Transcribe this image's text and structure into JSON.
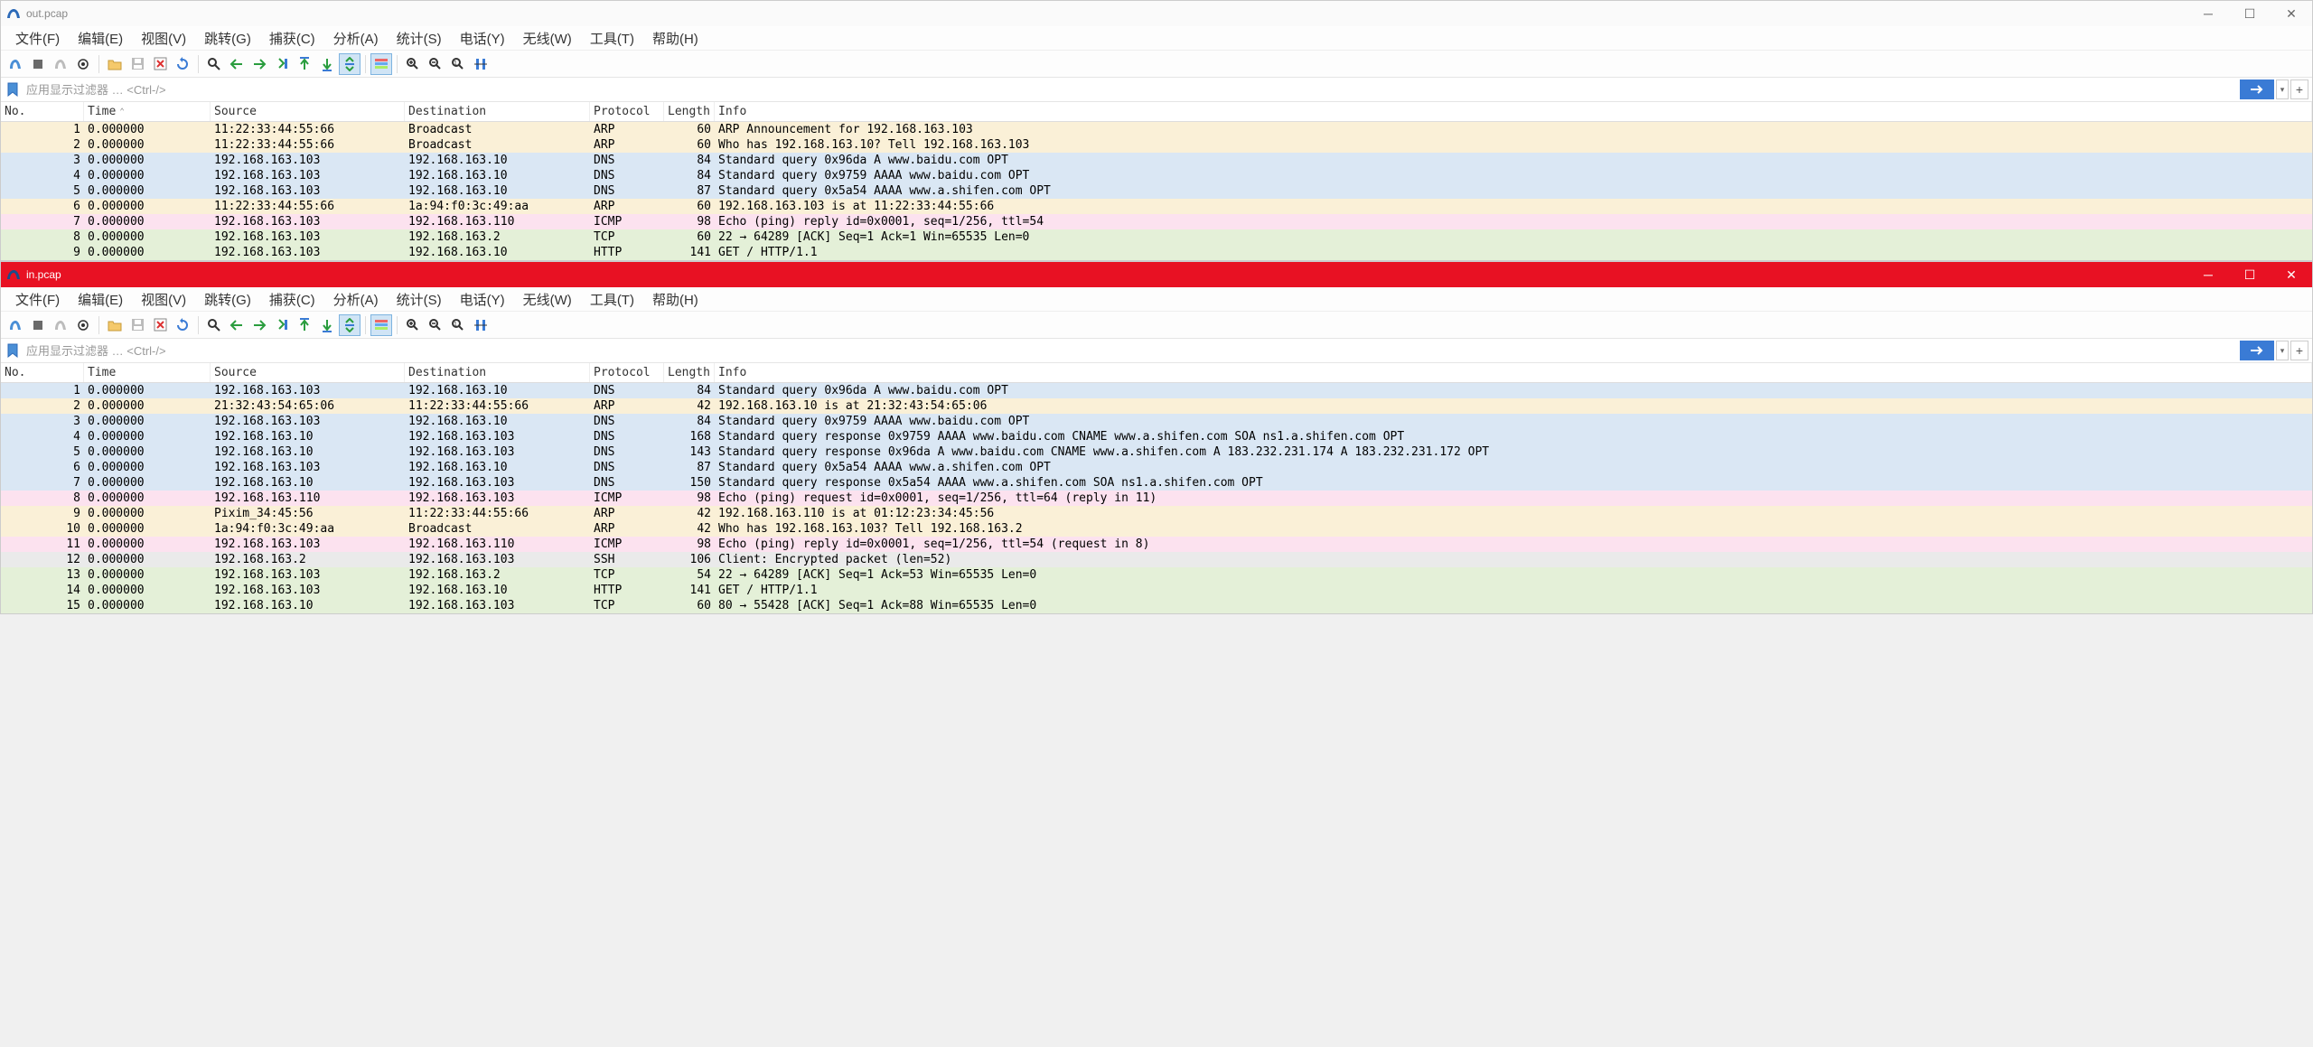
{
  "windows": {
    "out": {
      "title": "out.pcap"
    },
    "in": {
      "title": "in.pcap"
    }
  },
  "menu": {
    "file": "文件(F)",
    "edit": "编辑(E)",
    "view": "视图(V)",
    "goto": "跳转(G)",
    "capture": "捕获(C)",
    "analyze": "分析(A)",
    "stats": "统计(S)",
    "tele": "电话(Y)",
    "wireless": "无线(W)",
    "tools": "工具(T)",
    "help": "帮助(H)"
  },
  "filter": {
    "placeholder": "应用显示过滤器 … <Ctrl-/>"
  },
  "cols": {
    "no": "No.",
    "time": "Time",
    "src": "Source",
    "dst": "Destination",
    "proto": "Protocol",
    "len": "Length",
    "info": "Info"
  },
  "out_rows": [
    {
      "no": "1",
      "time": "0.000000",
      "src": "11:22:33:44:55:66",
      "dst": "Broadcast",
      "proto": "ARP",
      "len": "60",
      "info": "ARP Announcement for 192.168.163.103",
      "cls": "c-arp-cream"
    },
    {
      "no": "2",
      "time": "0.000000",
      "src": "11:22:33:44:55:66",
      "dst": "Broadcast",
      "proto": "ARP",
      "len": "60",
      "info": "Who has 192.168.163.10? Tell 192.168.163.103",
      "cls": "c-arp-cream"
    },
    {
      "no": "3",
      "time": "0.000000",
      "src": "192.168.163.103",
      "dst": "192.168.163.10",
      "proto": "DNS",
      "len": "84",
      "info": "Standard query 0x96da A www.baidu.com OPT",
      "cls": "c-dns-blue"
    },
    {
      "no": "4",
      "time": "0.000000",
      "src": "192.168.163.103",
      "dst": "192.168.163.10",
      "proto": "DNS",
      "len": "84",
      "info": "Standard query 0x9759 AAAA www.baidu.com OPT",
      "cls": "c-dns-blue"
    },
    {
      "no": "5",
      "time": "0.000000",
      "src": "192.168.163.103",
      "dst": "192.168.163.10",
      "proto": "DNS",
      "len": "87",
      "info": "Standard query 0x5a54 AAAA www.a.shifen.com OPT",
      "cls": "c-dns-blue"
    },
    {
      "no": "6",
      "time": "0.000000",
      "src": "11:22:33:44:55:66",
      "dst": "1a:94:f0:3c:49:aa",
      "proto": "ARP",
      "len": "60",
      "info": "192.168.163.103 is at 11:22:33:44:55:66",
      "cls": "c-arp-cream"
    },
    {
      "no": "7",
      "time": "0.000000",
      "src": "192.168.163.103",
      "dst": "192.168.163.110",
      "proto": "ICMP",
      "len": "98",
      "info": "Echo (ping) reply    id=0x0001, seq=1/256, ttl=54",
      "cls": "c-icmp-pink"
    },
    {
      "no": "8",
      "time": "0.000000",
      "src": "192.168.163.103",
      "dst": "192.168.163.2",
      "proto": "TCP",
      "len": "60",
      "info": "22 → 64289 [ACK] Seq=1 Ack=1 Win=65535 Len=0",
      "cls": "c-tcp-green"
    },
    {
      "no": "9",
      "time": "0.000000",
      "src": "192.168.163.103",
      "dst": "192.168.163.10",
      "proto": "HTTP",
      "len": "141",
      "info": "GET / HTTP/1.1",
      "cls": "c-http-green"
    }
  ],
  "in_rows": [
    {
      "no": "1",
      "time": "0.000000",
      "src": "192.168.163.103",
      "dst": "192.168.163.10",
      "proto": "DNS",
      "len": "84",
      "info": "Standard query 0x96da A www.baidu.com OPT",
      "cls": "c-dns-blue"
    },
    {
      "no": "2",
      "time": "0.000000",
      "src": "21:32:43:54:65:06",
      "dst": "11:22:33:44:55:66",
      "proto": "ARP",
      "len": "42",
      "info": "192.168.163.10 is at 21:32:43:54:65:06",
      "cls": "c-arp-cream"
    },
    {
      "no": "3",
      "time": "0.000000",
      "src": "192.168.163.103",
      "dst": "192.168.163.10",
      "proto": "DNS",
      "len": "84",
      "info": "Standard query 0x9759 AAAA www.baidu.com OPT",
      "cls": "c-dns-blue"
    },
    {
      "no": "4",
      "time": "0.000000",
      "src": "192.168.163.10",
      "dst": "192.168.163.103",
      "proto": "DNS",
      "len": "168",
      "info": "Standard query response 0x9759 AAAA www.baidu.com CNAME www.a.shifen.com SOA ns1.a.shifen.com OPT",
      "cls": "c-dns-blue"
    },
    {
      "no": "5",
      "time": "0.000000",
      "src": "192.168.163.10",
      "dst": "192.168.163.103",
      "proto": "DNS",
      "len": "143",
      "info": "Standard query response 0x96da A www.baidu.com CNAME www.a.shifen.com A 183.232.231.174 A 183.232.231.172 OPT",
      "cls": "c-dns-blue"
    },
    {
      "no": "6",
      "time": "0.000000",
      "src": "192.168.163.103",
      "dst": "192.168.163.10",
      "proto": "DNS",
      "len": "87",
      "info": "Standard query 0x5a54 AAAA www.a.shifen.com OPT",
      "cls": "c-dns-blue"
    },
    {
      "no": "7",
      "time": "0.000000",
      "src": "192.168.163.10",
      "dst": "192.168.163.103",
      "proto": "DNS",
      "len": "150",
      "info": "Standard query response 0x5a54 AAAA www.a.shifen.com SOA ns1.a.shifen.com OPT",
      "cls": "c-dns-blue"
    },
    {
      "no": "8",
      "time": "0.000000",
      "src": "192.168.163.110",
      "dst": "192.168.163.103",
      "proto": "ICMP",
      "len": "98",
      "info": "Echo (ping) request  id=0x0001, seq=1/256, ttl=64 (reply in 11)",
      "cls": "c-icmp-pink"
    },
    {
      "no": "9",
      "time": "0.000000",
      "src": "Pixim_34:45:56",
      "dst": "11:22:33:44:55:66",
      "proto": "ARP",
      "len": "42",
      "info": "192.168.163.110 is at 01:12:23:34:45:56",
      "cls": "c-arp-cream"
    },
    {
      "no": "10",
      "time": "0.000000",
      "src": "1a:94:f0:3c:49:aa",
      "dst": "Broadcast",
      "proto": "ARP",
      "len": "42",
      "info": "Who has 192.168.163.103? Tell 192.168.163.2",
      "cls": "c-arp-cream"
    },
    {
      "no": "11",
      "time": "0.000000",
      "src": "192.168.163.103",
      "dst": "192.168.163.110",
      "proto": "ICMP",
      "len": "98",
      "info": "Echo (ping) reply    id=0x0001, seq=1/256, ttl=54 (request in 8)",
      "cls": "c-icmp-pink"
    },
    {
      "no": "12",
      "time": "0.000000",
      "src": "192.168.163.2",
      "dst": "192.168.163.103",
      "proto": "SSH",
      "len": "106",
      "info": "Client: Encrypted packet (len=52)",
      "cls": "c-ssh-gray"
    },
    {
      "no": "13",
      "time": "0.000000",
      "src": "192.168.163.103",
      "dst": "192.168.163.2",
      "proto": "TCP",
      "len": "54",
      "info": "22 → 64289 [ACK] Seq=1 Ack=53 Win=65535 Len=0",
      "cls": "c-tcp-green"
    },
    {
      "no": "14",
      "time": "0.000000",
      "src": "192.168.163.103",
      "dst": "192.168.163.10",
      "proto": "HTTP",
      "len": "141",
      "info": "GET / HTTP/1.1",
      "cls": "c-http-green"
    },
    {
      "no": "15",
      "time": "0.000000",
      "src": "192.168.163.10",
      "dst": "192.168.163.103",
      "proto": "TCP",
      "len": "60",
      "info": "80 → 55428 [ACK] Seq=1 Ack=88 Win=65535 Len=0",
      "cls": "c-tcp-green"
    }
  ]
}
